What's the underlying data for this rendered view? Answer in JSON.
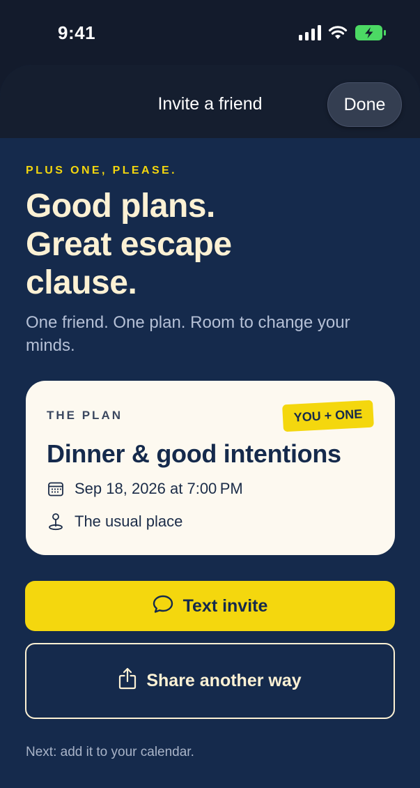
{
  "status_bar": {
    "time": "9:41",
    "icons": [
      "signal-icon",
      "wifi-icon",
      "battery-charging-icon"
    ],
    "battery_color": "#4cd964"
  },
  "header": {
    "title": "Invite a friend",
    "done_label": "Done"
  },
  "hero": {
    "eyebrow": "PLUS ONE, PLEASE.",
    "headline_line1": "Good plans.",
    "headline_line2": "Great escape",
    "headline_line3": "clause.",
    "subtitle": "One friend. One plan. Room to change your minds."
  },
  "plan_card": {
    "label": "THE PLAN",
    "badge": "YOU + ONE",
    "title": "Dinner & good intentions",
    "date": "Sep 18, 2026 at 7:00 PM",
    "place": "The usual place"
  },
  "actions": {
    "text_invite_label": "Text invite",
    "share_label": "Share another way"
  },
  "footer": {
    "hint": "Next: add it to your calendar."
  },
  "colors": {
    "accent": "#f4d70e",
    "background": "#152a4c",
    "header_background": "#151e2f",
    "cream": "#fcf1d4",
    "card": "#fdf9f0"
  }
}
